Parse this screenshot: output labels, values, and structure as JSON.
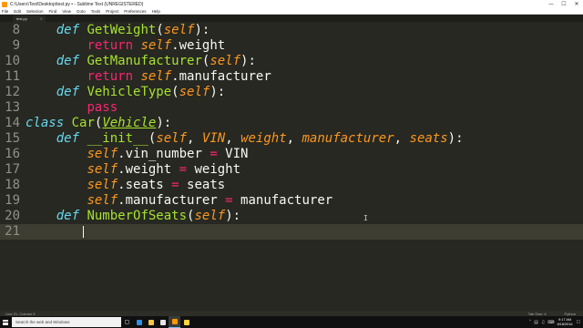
{
  "window": {
    "title": "C:\\Users\\Test\\Desktop\\test.py • - Sublime Text (UNREGISTERED)",
    "minimize": "—",
    "maximize": "☐",
    "close": "✕"
  },
  "menu": [
    "File",
    "Edit",
    "Selection",
    "Find",
    "View",
    "Goto",
    "Tools",
    "Project",
    "Preferences",
    "Help"
  ],
  "tab": {
    "label": "test.py",
    "close": "×"
  },
  "editor": {
    "lines": [
      {
        "n": "8",
        "segments": [
          [
            "",
            "    "
          ],
          [
            "kw",
            "def"
          ],
          [
            "",
            " "
          ],
          [
            "fn",
            "GetWeight"
          ],
          [
            "",
            "("
          ],
          [
            "sf",
            "self"
          ],
          [
            "",
            "):"
          ]
        ]
      },
      {
        "n": "9",
        "segments": [
          [
            "",
            "        "
          ],
          [
            "rt",
            "return"
          ],
          [
            "",
            " "
          ],
          [
            "sf",
            "self"
          ],
          [
            "",
            ".weight"
          ]
        ]
      },
      {
        "n": "10",
        "segments": [
          [
            "",
            "    "
          ],
          [
            "kw",
            "def"
          ],
          [
            "",
            " "
          ],
          [
            "fn",
            "GetManufacturer"
          ],
          [
            "",
            "("
          ],
          [
            "sf",
            "self"
          ],
          [
            "",
            "):"
          ]
        ]
      },
      {
        "n": "11",
        "segments": [
          [
            "",
            "        "
          ],
          [
            "rt",
            "return"
          ],
          [
            "",
            " "
          ],
          [
            "sf",
            "self"
          ],
          [
            "",
            ".manufacturer"
          ]
        ]
      },
      {
        "n": "12",
        "segments": [
          [
            "",
            "    "
          ],
          [
            "kw",
            "def"
          ],
          [
            "",
            " "
          ],
          [
            "fn",
            "VehicleType"
          ],
          [
            "",
            "("
          ],
          [
            "sf",
            "self"
          ],
          [
            "",
            "):"
          ]
        ]
      },
      {
        "n": "13",
        "segments": [
          [
            "",
            "        "
          ],
          [
            "rt",
            "pass"
          ]
        ]
      },
      {
        "n": "14",
        "segments": [
          [
            "kw",
            "class"
          ],
          [
            "",
            " "
          ],
          [
            "fn",
            "Car"
          ],
          [
            "",
            "("
          ],
          [
            "inh",
            "Vehicle"
          ],
          [
            "",
            "):"
          ]
        ]
      },
      {
        "n": "15",
        "segments": [
          [
            "",
            "    "
          ],
          [
            "kw",
            "def"
          ],
          [
            "",
            " "
          ],
          [
            "fn",
            "__init__"
          ],
          [
            "",
            "("
          ],
          [
            "sf",
            "self"
          ],
          [
            "",
            ", "
          ],
          [
            "sf",
            "VIN"
          ],
          [
            "",
            ", "
          ],
          [
            "sf",
            "weight"
          ],
          [
            "",
            ", "
          ],
          [
            "sf",
            "manufacturer"
          ],
          [
            "",
            ", "
          ],
          [
            "sf",
            "seats"
          ],
          [
            "",
            "):"
          ]
        ]
      },
      {
        "n": "16",
        "segments": [
          [
            "",
            "        "
          ],
          [
            "sf",
            "self"
          ],
          [
            "",
            ".vin_number "
          ],
          [
            "op",
            "="
          ],
          [
            "",
            " VIN"
          ]
        ]
      },
      {
        "n": "17",
        "segments": [
          [
            "",
            "        "
          ],
          [
            "sf",
            "self"
          ],
          [
            "",
            ".weight "
          ],
          [
            "op",
            "="
          ],
          [
            "",
            " weight"
          ]
        ]
      },
      {
        "n": "18",
        "segments": [
          [
            "",
            "        "
          ],
          [
            "sf",
            "self"
          ],
          [
            "",
            ".seats "
          ],
          [
            "op",
            "="
          ],
          [
            "",
            " seats"
          ]
        ]
      },
      {
        "n": "19",
        "segments": [
          [
            "",
            "        "
          ],
          [
            "sf",
            "self"
          ],
          [
            "",
            ".manufacturer "
          ],
          [
            "op",
            "="
          ],
          [
            "",
            " manufacturer"
          ]
        ]
      },
      {
        "n": "20",
        "segments": [
          [
            "",
            "    "
          ],
          [
            "kw",
            "def"
          ],
          [
            "",
            " "
          ],
          [
            "fn",
            "NumberOfSeats"
          ],
          [
            "",
            "("
          ],
          [
            "sf",
            "self"
          ],
          [
            "",
            "):"
          ]
        ]
      },
      {
        "n": "21",
        "segments": [
          [
            "",
            "        "
          ]
        ],
        "current": true
      }
    ]
  },
  "statusbar": {
    "position": "Line 21, Column 9",
    "tab_size": "Tab Size: 4",
    "syntax": "Python"
  },
  "taskbar": {
    "search_placeholder": "Search the web and Windows",
    "icons": [
      "task-view-icon",
      "edge-icon",
      "file-explorer-icon",
      "store-icon",
      "sublime-text-icon",
      "python-icon"
    ],
    "time": "9:17 AM",
    "date": "8/18/2016"
  },
  "colors": {
    "background": "#272822",
    "keyword": "#66d9ef",
    "function": "#a6e22e",
    "self": "#fd971f",
    "return": "#f92672"
  }
}
